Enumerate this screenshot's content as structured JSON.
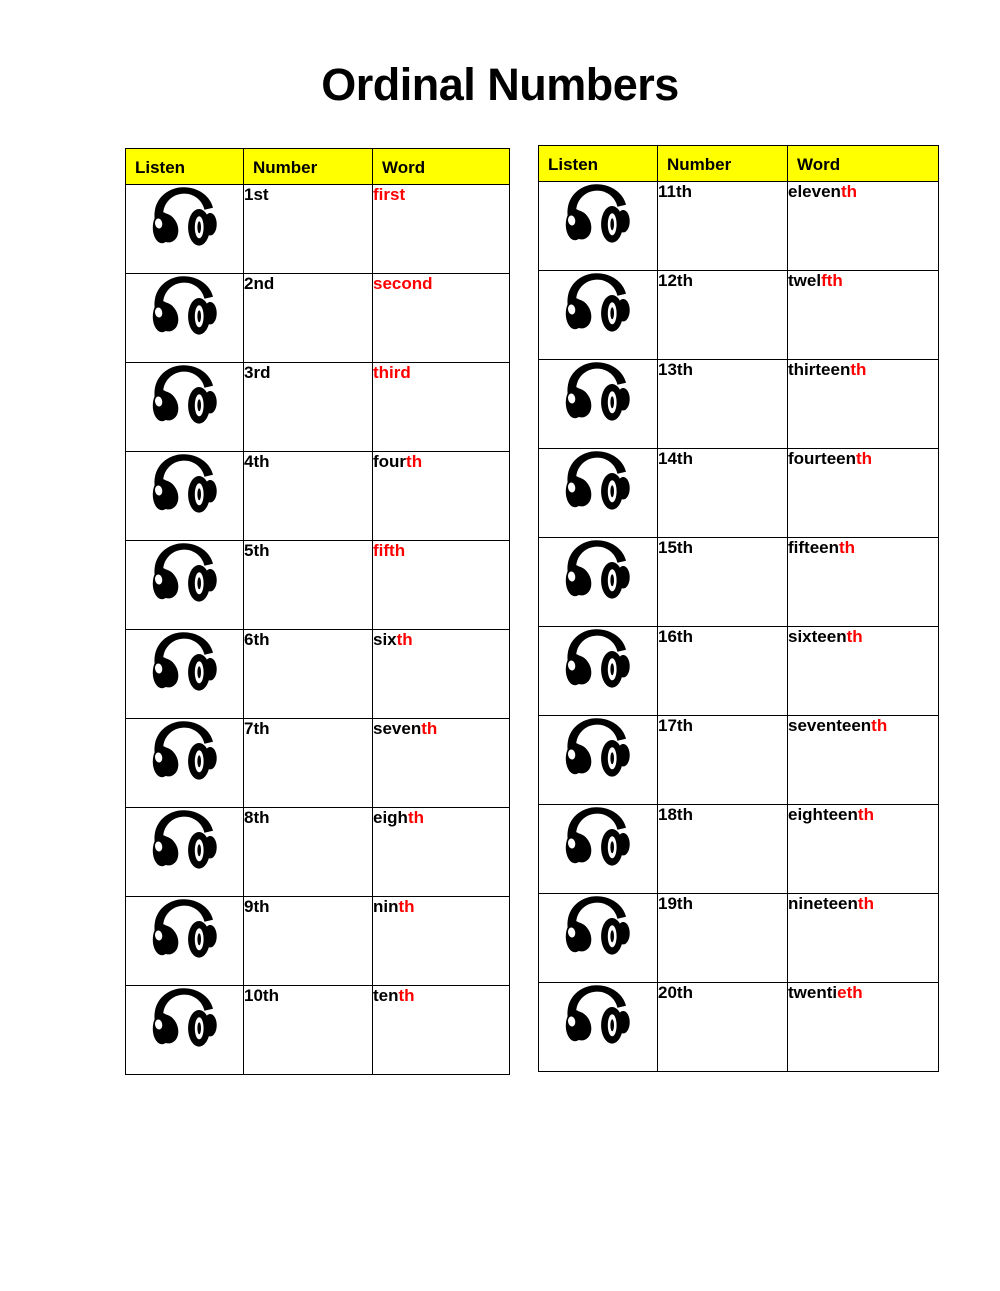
{
  "title": "Ordinal Numbers",
  "colors": {
    "header_bg": "#ffff00",
    "header_text": "#000000",
    "accent_red": "#ff0000",
    "text": "#000000",
    "border": "#000000",
    "page_bg": "#ffffff"
  },
  "tables": [
    {
      "id": "ordinals-1-10",
      "headers": {
        "listen": "Listen",
        "number": "Number",
        "word": "Word"
      },
      "rows": [
        {
          "icon": "headphones-icon",
          "number": "1st",
          "word": "first",
          "word_black": "",
          "word_red": "first"
        },
        {
          "icon": "headphones-icon",
          "number": "2nd",
          "word": "second",
          "word_black": "",
          "word_red": "second"
        },
        {
          "icon": "headphones-icon",
          "number": "3rd",
          "word": "third",
          "word_black": "",
          "word_red": "third"
        },
        {
          "icon": "headphones-icon",
          "number": "4th",
          "word": "fourth",
          "word_black": "four",
          "word_red": "th"
        },
        {
          "icon": "headphones-icon",
          "number": "5th",
          "word": "fifth",
          "word_black": "",
          "word_red": "fifth"
        },
        {
          "icon": "headphones-icon",
          "number": "6th",
          "word": "sixth",
          "word_black": "six",
          "word_red": "th"
        },
        {
          "icon": "headphones-icon",
          "number": "7th",
          "word": "seventh",
          "word_black": "seven",
          "word_red": "th"
        },
        {
          "icon": "headphones-icon",
          "number": "8th",
          "word": "eighth",
          "word_black": "eigh",
          "word_red": "th"
        },
        {
          "icon": "headphones-icon",
          "number": "9th",
          "word": "ninth",
          "word_black": "nin",
          "word_red": "th"
        },
        {
          "icon": "headphones-icon",
          "number": "10th",
          "word": "tenth",
          "word_black": "ten",
          "word_red": "th"
        }
      ]
    },
    {
      "id": "ordinals-11-20",
      "headers": {
        "listen": "Listen",
        "number": "Number",
        "word": "Word"
      },
      "rows": [
        {
          "icon": "headphones-icon",
          "number": "11th",
          "word": "eleventh",
          "word_black": "eleven",
          "word_red": "th"
        },
        {
          "icon": "headphones-icon",
          "number": "12th",
          "word": "twelfth",
          "word_black": "twel",
          "word_red": "fth"
        },
        {
          "icon": "headphones-icon",
          "number": "13th",
          "word": "thirteenth",
          "word_black": "thirteen",
          "word_red": "th"
        },
        {
          "icon": "headphones-icon",
          "number": "14th",
          "word": "fourteenth",
          "word_black": "fourteen",
          "word_red": "th"
        },
        {
          "icon": "headphones-icon",
          "number": "15th",
          "word": "fifteenth",
          "word_black": "fifteen",
          "word_red": "th"
        },
        {
          "icon": "headphones-icon",
          "number": "16th",
          "word": "sixteenth",
          "word_black": "sixteen",
          "word_red": "th"
        },
        {
          "icon": "headphones-icon",
          "number": "17th",
          "word": "seventeenth",
          "word_black": "seventeen",
          "word_red": "th"
        },
        {
          "icon": "headphones-icon",
          "number": "18th",
          "word": "eighteenth",
          "word_black": "eighteen",
          "word_red": "th"
        },
        {
          "icon": "headphones-icon",
          "number": "19th",
          "word": "nineteenth",
          "word_black": "nineteen",
          "word_red": "th"
        },
        {
          "icon": "headphones-icon",
          "number": "20th",
          "word": "twentieth",
          "word_black": "twenti",
          "word_red": "eth"
        }
      ]
    }
  ]
}
